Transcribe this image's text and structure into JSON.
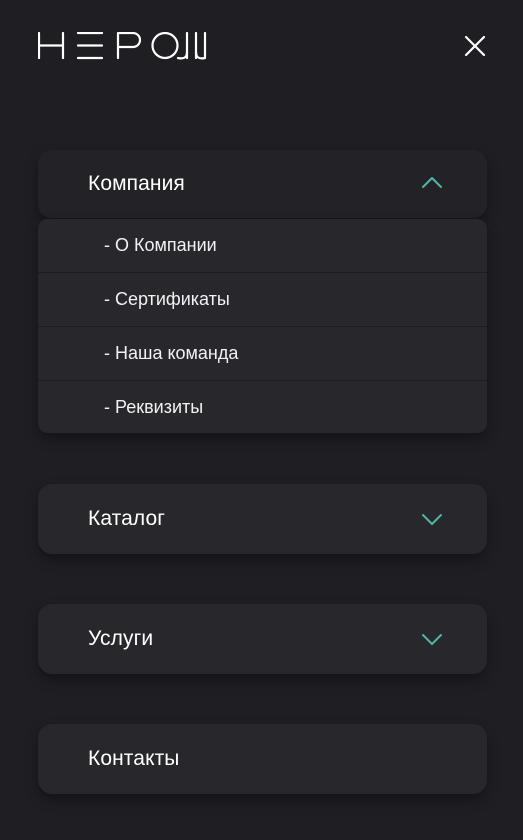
{
  "header": {
    "logo_text": "HEPOLL",
    "close_icon": "close-icon"
  },
  "menu": {
    "company": {
      "label": "Компания",
      "expanded": true,
      "items": [
        "- О Компании",
        "- Сертификаты",
        "- Наша команда",
        "- Реквизиты"
      ]
    },
    "catalog": {
      "label": "Каталог",
      "expanded": false
    },
    "services": {
      "label": "Услуги",
      "expanded": false
    },
    "contacts": {
      "label": "Контакты"
    }
  },
  "colors": {
    "background": "#1f1e22",
    "panel": "#28272c",
    "accent": "#4fb6a6"
  }
}
